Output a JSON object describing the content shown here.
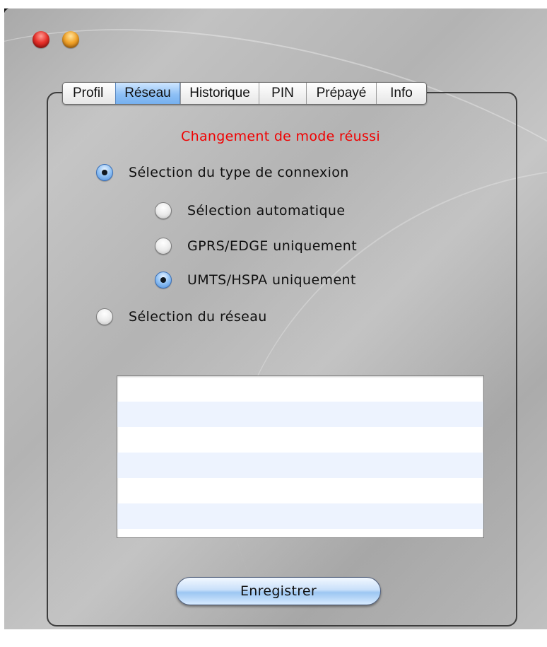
{
  "window": {
    "controls": [
      {
        "name": "close-button",
        "color": "#e8312b"
      },
      {
        "name": "minimize-button",
        "color": "#f2a42a"
      }
    ]
  },
  "tabs": [
    {
      "label": "Profil",
      "selected": false
    },
    {
      "label": "Réseau",
      "selected": true
    },
    {
      "label": "Historique",
      "selected": false
    },
    {
      "label": "PIN",
      "selected": false
    },
    {
      "label": "Prépayé",
      "selected": false
    },
    {
      "label": "Info",
      "selected": false
    }
  ],
  "status": {
    "text": "Changement de mode réussi",
    "color": "#f00000"
  },
  "options": {
    "connection_type": {
      "label": "Sélection du type de connexion",
      "checked": true
    },
    "auto": {
      "label": "Sélection automatique",
      "checked": false
    },
    "gprs_edge": {
      "label": "GPRS/EDGE uniquement",
      "checked": false
    },
    "umts_hspa": {
      "label": "UMTS/HSPA uniquement",
      "checked": true
    },
    "network": {
      "label": "Sélection du réseau",
      "checked": false
    }
  },
  "network_list": {
    "rows": [
      "",
      "",
      "",
      "",
      "",
      ""
    ]
  },
  "save_button": {
    "label": "Enregistrer"
  }
}
